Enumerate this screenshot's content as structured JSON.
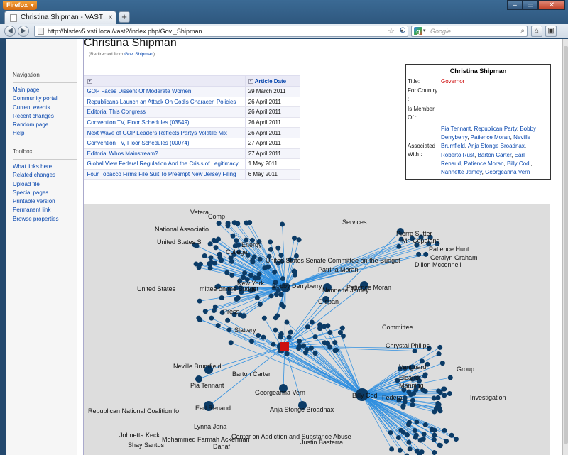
{
  "browser": {
    "menu_label": "Firefox",
    "window_controls": {
      "minimize": "–",
      "maximize": "▭",
      "close": "✕"
    },
    "tab_title": "Christina Shipman - VAST",
    "url": "http://blsdev5.vsti.local/vast2/index.php/Gov._Shipman",
    "search_placeholder": "Google",
    "search_engine_letter": "g",
    "buttons": {
      "back": "◀",
      "forward": "▶",
      "reload": "C",
      "home": "⌂",
      "addons": "▣",
      "new_tab": "+",
      "tab_close": "x",
      "star": "☆",
      "dropdown": "▾",
      "search_go": "🔍"
    }
  },
  "sidebar": {
    "navigation_heading": "Navigation",
    "navigation_items": [
      "Main page",
      "Community portal",
      "Current events",
      "Recent changes",
      "Random page",
      "Help"
    ],
    "toolbox_heading": "Toolbox",
    "toolbox_items": [
      "What links here",
      "Related changes",
      "Upload file",
      "Special pages",
      "Printable version",
      "Permanent link",
      "Browse properties"
    ]
  },
  "page": {
    "title": "Christina Shipman",
    "redirect_prefix": "(Redirected from ",
    "redirect_link": "Gov. Shipman",
    "redirect_suffix": ")"
  },
  "articles_table": {
    "headers": {
      "title": "",
      "date": "Article Date"
    },
    "rows": [
      {
        "title": "GOP Faces Dissent Of Moderate Women",
        "date": "29 March 2011"
      },
      {
        "title": "Republicans Launch an Attack On Codis Characer, Policies",
        "date": "26 April 2011"
      },
      {
        "title": "Editorial This Congress",
        "date": "26 April 2011"
      },
      {
        "title": "Convention TV, Floor Schedules (03549)",
        "date": "26 April 2011"
      },
      {
        "title": "Next Wave of GOP Leaders Reflects Partys Volatile Mix",
        "date": "26 April 2011"
      },
      {
        "title": "Convention TV, Floor Schedules (00074)",
        "date": "27 April 2011"
      },
      {
        "title": "Editorial Whos Mainstream?",
        "date": "27 April 2011"
      },
      {
        "title": "Global View Federal Regulation And the Crisis of Legitimacy",
        "date": "1 May 2011"
      },
      {
        "title": "Four Tobacco Firms File Suit To Preempt New Jersey Filing",
        "date": "6 May 2011"
      }
    ]
  },
  "infobox": {
    "name": "Christina Shipman",
    "title_label": "Title:",
    "title_value": "Governor",
    "for_country_label": "For Country :",
    "member_of_label": "Is Member Of :",
    "associated_label": "Associated With :",
    "associated": [
      "Pia Tennant",
      "Republican Party",
      "Bobby Derryberry",
      "Patience Moran",
      "Neville Brumfield",
      "Anja Stonge Broadnax",
      "Roberto Rust",
      "Barton Carter",
      "Earl Renaud",
      "Patience Moran",
      "Billy Codi",
      "Nannette Jamey",
      "Georgeanna Vern"
    ]
  },
  "graph": {
    "colors": {
      "edge": "#2f8fe0",
      "node": "#0b3b66",
      "focus": "#cc1111",
      "background": "#dddddd"
    },
    "labels": [
      "Vetera",
      "Comp",
      "Services",
      "National Associatio",
      "Pierre Sutter",
      "Mr. Copeland",
      "United States S",
      "Energy",
      "College",
      "Patience Hunt",
      "Geralyn Graham",
      "United States Senate Committee on the Budget",
      "Dillon Mcconnell",
      "Patrina Moran",
      "New York",
      "United States",
      "mittee on the Budget",
      "Bobby Derryberry",
      "Nannette Jamey",
      "Patience Moran",
      "C-span",
      "Press",
      "Slattery",
      "Committee",
      "Chrystal Philips",
      "Neville Brumfield",
      "Barton Carter",
      "Pia Tennant",
      "Georgeanna Vern",
      "Billy Codi",
      "Republican National Coalition fo",
      "Earl Renaud",
      "Anja Stonge Broadnax",
      "Lynna Jona",
      "Johnetta Keck",
      "Shay Santos",
      "Mohammed Farmah Ackerman",
      "Danaf",
      "Center on Addiction and Substance Abuse",
      "Justin Basterra",
      "Vanguard",
      "Investigation",
      "Federa",
      "Manning",
      "Eleanor",
      "Group"
    ]
  }
}
